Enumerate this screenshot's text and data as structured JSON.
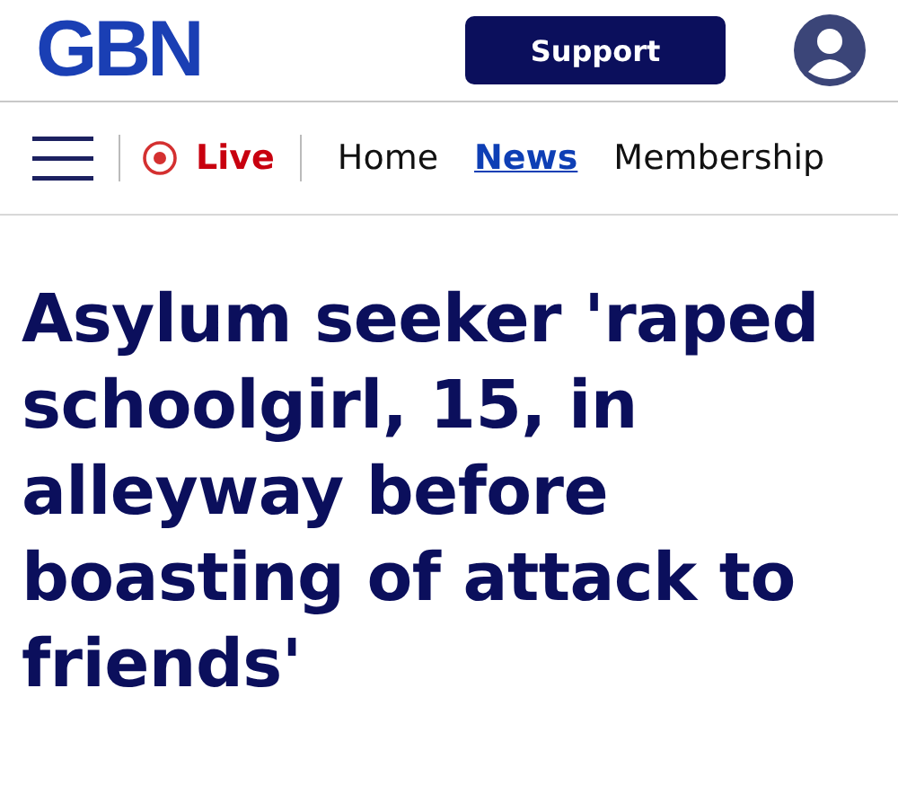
{
  "header": {
    "logo": "GBN",
    "support_button": "Support"
  },
  "nav": {
    "live": "Live",
    "items": [
      {
        "label": "Home",
        "selected": false
      },
      {
        "label": "News",
        "selected": true
      },
      {
        "label": "Membership",
        "selected": false
      }
    ]
  },
  "headline": "Asylum seeker 'raped schoolgirl, 15, in alleyway before boasting of attack to friends'"
}
